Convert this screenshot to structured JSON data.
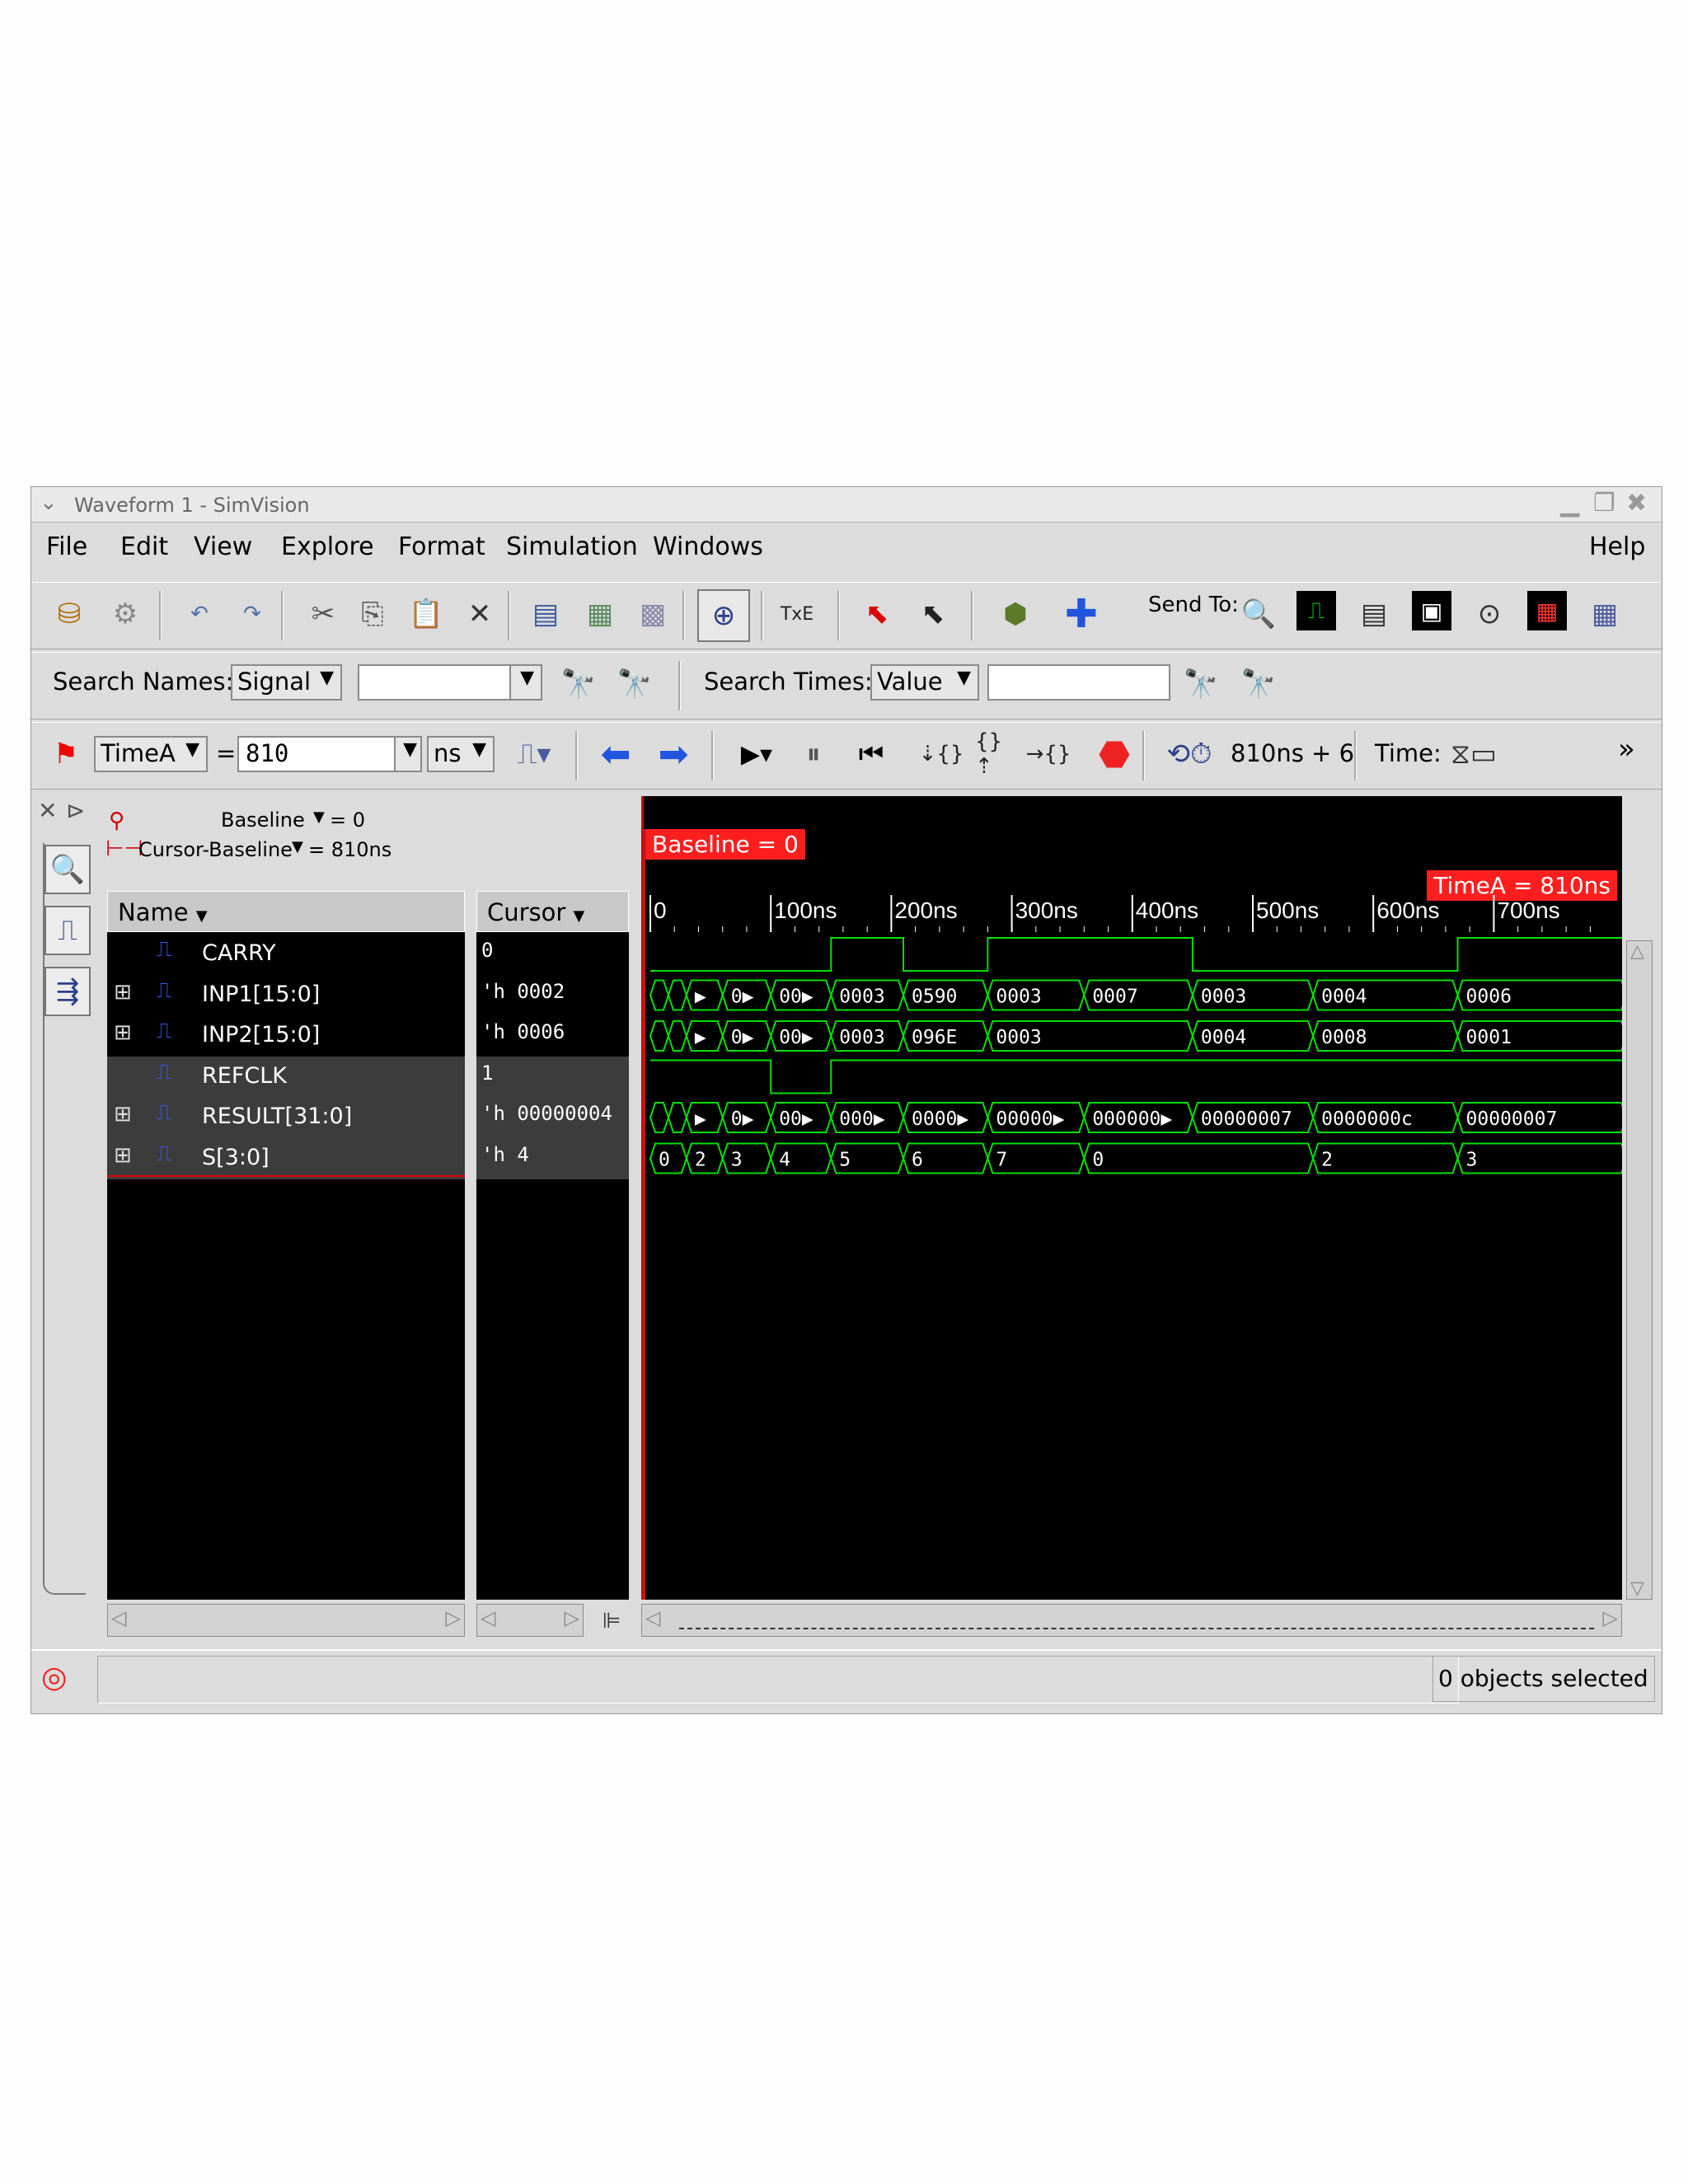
{
  "window": {
    "title": "Waveform 1 - SimVision"
  },
  "menu": {
    "file": "File",
    "edit": "Edit",
    "view": "View",
    "explore": "Explore",
    "format": "Format",
    "simulation": "Simulation",
    "windows": "Windows",
    "help": "Help"
  },
  "toolbar": {
    "send_to": "Send To:"
  },
  "search": {
    "names_label": "Search Names:",
    "names_type": "Signal",
    "names_value": "",
    "times_label": "Search Times:",
    "times_type": "Value",
    "times_value": ""
  },
  "cursorbar": {
    "cursor_name": "TimeA",
    "equals": "=",
    "time_value": "810",
    "unit": "ns",
    "sim_time": "810ns + 6",
    "time_label": "Time:",
    "more": "»"
  },
  "sidepanel": {
    "baseline": "Baseline",
    "baseline_value": "= 0",
    "cursor_baseline": "Cursor-Baseline",
    "cursor_baseline_value": "= 810ns"
  },
  "columns": {
    "name": "Name",
    "cursor": "Cursor"
  },
  "signals": [
    {
      "name": "CARRY",
      "value": "0",
      "expandable": false
    },
    {
      "name": "INP1[15:0]",
      "value": "'h 0002",
      "expandable": true
    },
    {
      "name": "INP2[15:0]",
      "value": "'h 0006",
      "expandable": true
    },
    {
      "name": "REFCLK",
      "value": "1",
      "expandable": false
    },
    {
      "name": "RESULT[31:0]",
      "value": "'h 00000004",
      "expandable": true
    },
    {
      "name": "S[3:0]",
      "value": "'h 4",
      "expandable": true
    }
  ],
  "waveform": {
    "baseline_tag": "Baseline = 0",
    "cursor_tag": "TimeA = 810ns",
    "ticks": [
      "0",
      "100ns",
      "200ns",
      "300ns",
      "400ns",
      "500ns",
      "600ns",
      "700ns"
    ],
    "time_max_ns": 810,
    "carry": [
      [
        0,
        0
      ],
      [
        150,
        1
      ],
      [
        210,
        0
      ],
      [
        280,
        1
      ],
      [
        450,
        0
      ],
      [
        670,
        1
      ],
      [
        810,
        1
      ]
    ],
    "refclk": [
      [
        0,
        1
      ],
      [
        100,
        0
      ],
      [
        150,
        1
      ],
      [
        810,
        1
      ]
    ],
    "buses": [
      {
        "row": 1,
        "segments": [
          [
            0,
            ""
          ],
          [
            15,
            ""
          ],
          [
            30,
            "▶"
          ],
          [
            60,
            "0▶"
          ],
          [
            100,
            "00▶"
          ],
          [
            150,
            "0003"
          ],
          [
            210,
            "0590"
          ],
          [
            280,
            "0003"
          ],
          [
            360,
            "0007"
          ],
          [
            450,
            "0003"
          ],
          [
            550,
            "0004"
          ],
          [
            670,
            "0006"
          ]
        ]
      },
      {
        "row": 2,
        "segments": [
          [
            0,
            ""
          ],
          [
            15,
            ""
          ],
          [
            30,
            "▶"
          ],
          [
            60,
            "0▶"
          ],
          [
            100,
            "00▶"
          ],
          [
            150,
            "0003"
          ],
          [
            210,
            "096E"
          ],
          [
            280,
            "0003"
          ],
          [
            450,
            "0004"
          ],
          [
            550,
            "0008"
          ],
          [
            670,
            "0001"
          ]
        ]
      },
      {
        "row": 4,
        "segments": [
          [
            0,
            ""
          ],
          [
            15,
            ""
          ],
          [
            30,
            "▶"
          ],
          [
            60,
            "0▶"
          ],
          [
            100,
            "00▶"
          ],
          [
            150,
            "000▶"
          ],
          [
            210,
            "0000▶"
          ],
          [
            280,
            "00000▶"
          ],
          [
            360,
            "000000▶"
          ],
          [
            450,
            "00000007"
          ],
          [
            550,
            "0000000c"
          ],
          [
            670,
            "00000007"
          ]
        ]
      },
      {
        "row": 5,
        "segments": [
          [
            0,
            "0"
          ],
          [
            30,
            "2"
          ],
          [
            60,
            "3"
          ],
          [
            100,
            "4"
          ],
          [
            150,
            "5"
          ],
          [
            210,
            "6"
          ],
          [
            280,
            "7"
          ],
          [
            360,
            "0"
          ],
          [
            550,
            "2"
          ],
          [
            670,
            "3"
          ]
        ]
      }
    ]
  },
  "status": {
    "selection": "0 objects selected"
  },
  "colors": {
    "wave": "#00e000",
    "cursor": "#ff1e1e",
    "bg": "#000000"
  }
}
